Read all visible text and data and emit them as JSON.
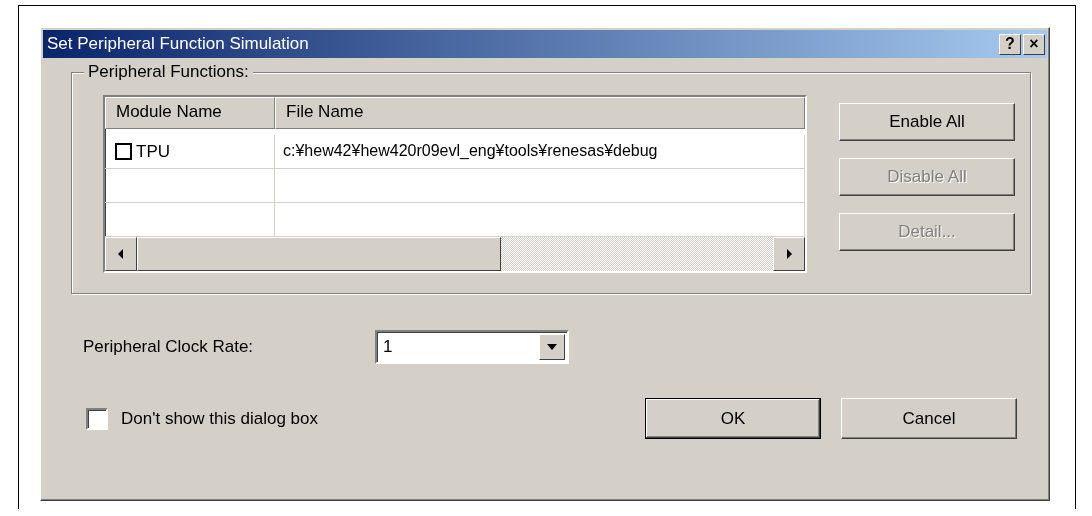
{
  "window": {
    "title": "Set Peripheral Function Simulation",
    "title_buttons": [
      "?",
      "×"
    ]
  },
  "peripheral_functions": {
    "label": "Peripheral Functions:",
    "columns": [
      "Module Name",
      "File Name"
    ],
    "rows": [
      {
        "checked": false,
        "module": "TPU",
        "file": "c:¥hew42¥hew420r09evl_eng¥tools¥renesas¥debug"
      }
    ],
    "buttons": [
      {
        "label": "Enable All",
        "disabled": false
      },
      {
        "label": "Disable All",
        "disabled": true
      },
      {
        "label": "Detail...",
        "disabled": true
      }
    ]
  },
  "clock_rate": {
    "label": "Peripheral Clock Rate:",
    "value": "1"
  },
  "dont_show": {
    "label": "Don't show this dialog box",
    "checked": false
  },
  "buttons": [
    {
      "label": "OK",
      "default": true
    },
    {
      "label": "Cancel",
      "default": false
    }
  ]
}
